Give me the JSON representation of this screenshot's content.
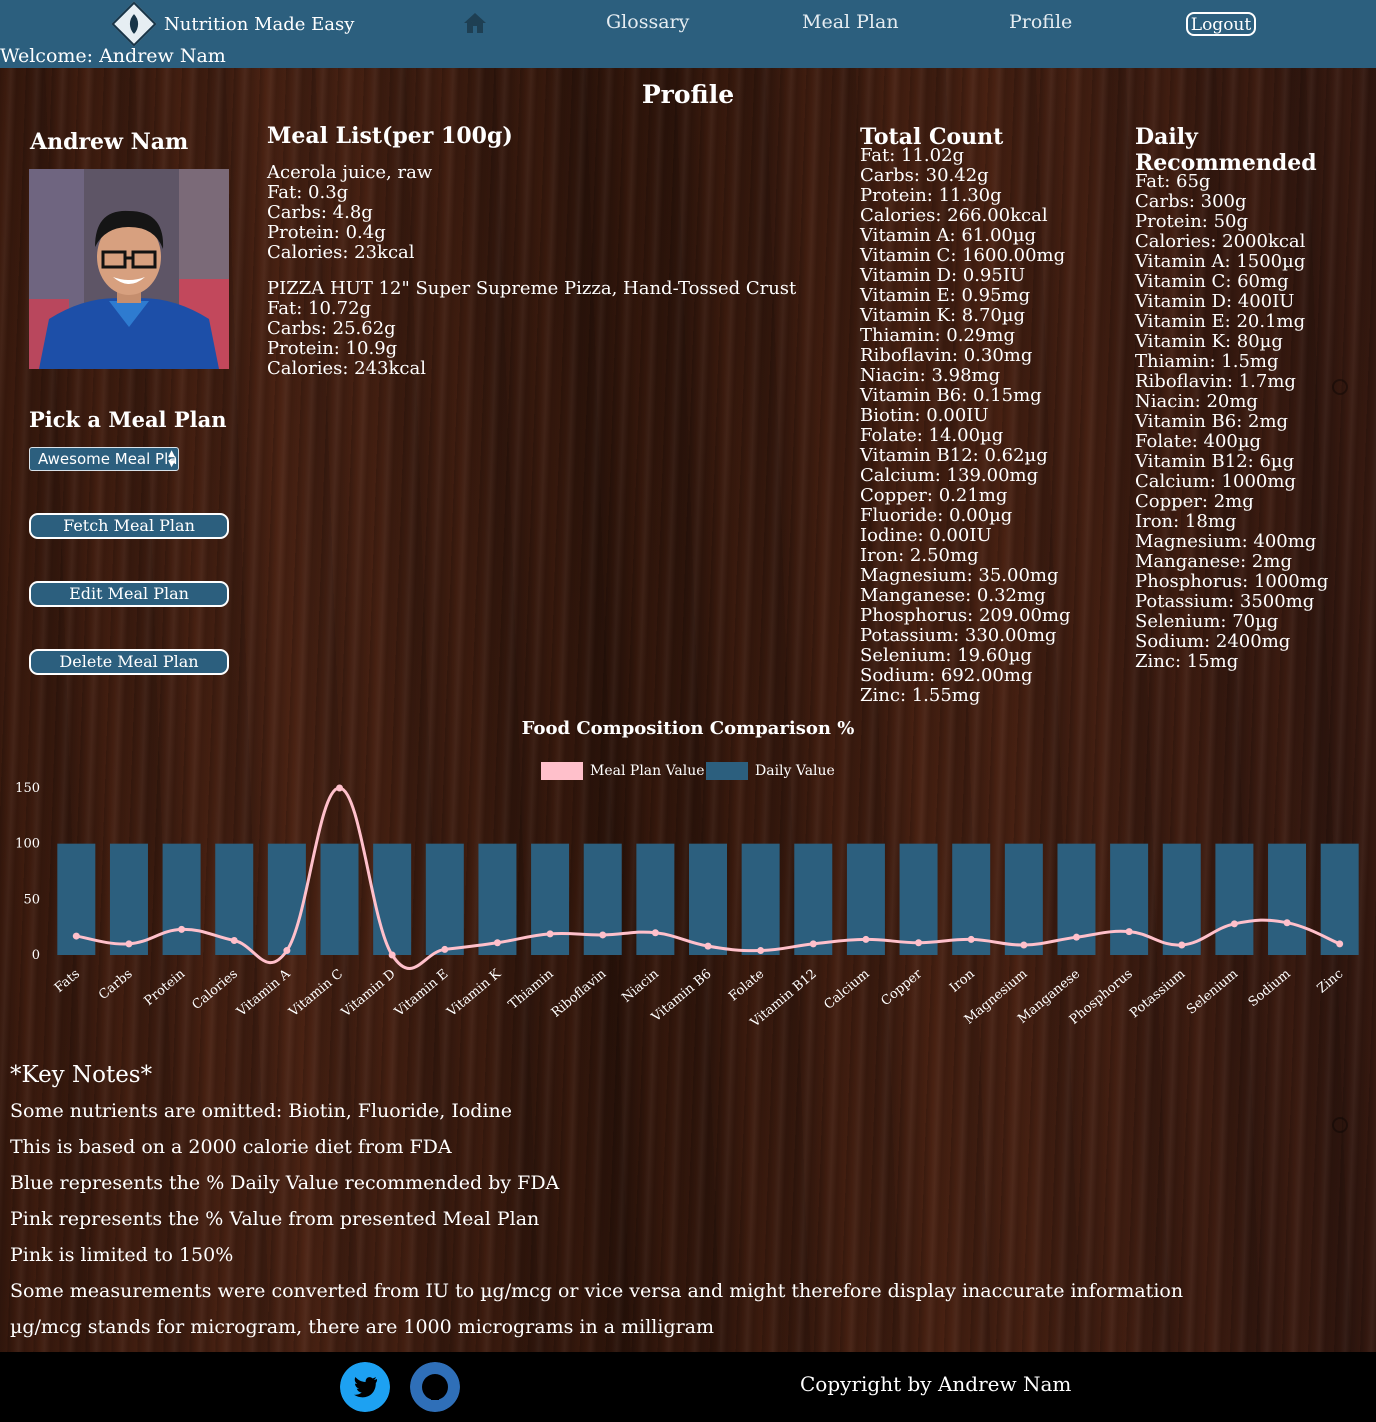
{
  "nav": {
    "brand": "Nutrition Made Easy",
    "links": [
      "Glossary",
      "Meal Plan",
      "Profile"
    ],
    "logout": "Logout",
    "welcome": "Welcome: Andrew Nam",
    "bar_color": "#2c5f7e"
  },
  "page_title": "Profile",
  "user": {
    "name": "Andrew Nam"
  },
  "meal_picker": {
    "title": "Pick a Meal Plan",
    "selected": "Awesome Meal Plan",
    "buttons": [
      "Fetch Meal Plan",
      "Edit Meal Plan",
      "Delete Meal Plan"
    ]
  },
  "meal_list": {
    "title": "Meal List(per 100g)",
    "items": [
      {
        "name": "Acerola juice, raw",
        "fat": "Fat: 0.3g",
        "carbs": "Carbs: 4.8g",
        "protein": "Protein: 0.4g",
        "calories": "Calories: 23kcal"
      },
      {
        "name": "PIZZA HUT 12\" Super Supreme Pizza, Hand-Tossed Crust",
        "fat": "Fat: 10.72g",
        "carbs": "Carbs: 25.62g",
        "protein": "Protein: 10.9g",
        "calories": "Calories: 243kcal"
      }
    ]
  },
  "total_count": {
    "title": "Total Count",
    "rows": [
      "Fat: 11.02g",
      "Carbs: 30.42g",
      "Protein: 11.30g",
      "Calories: 266.00kcal",
      "Vitamin A: 61.00µg",
      "Vitamin C: 1600.00mg",
      "Vitamin D: 0.95IU",
      "Vitamin E: 0.95mg",
      "Vitamin K: 8.70µg",
      "Thiamin: 0.29mg",
      "Riboflavin: 0.30mg",
      "Niacin: 3.98mg",
      "Vitamin B6: 0.15mg",
      "Biotin: 0.00IU",
      "Folate: 14.00µg",
      "Vitamin B12: 0.62µg",
      "Calcium: 139.00mg",
      "Copper: 0.21mg",
      "Fluoride: 0.00µg",
      "Iodine: 0.00IU",
      "Iron: 2.50mg",
      "Magnesium: 35.00mg",
      "Manganese: 0.32mg",
      "Phosphorus: 209.00mg",
      "Potassium: 330.00mg",
      "Selenium: 19.60µg",
      "Sodium: 692.00mg",
      "Zinc: 1.55mg"
    ]
  },
  "daily_recommended": {
    "title": "Daily Recommended",
    "rows": [
      "Fat: 65g",
      "Carbs: 300g",
      "Protein: 50g",
      "Calories: 2000kcal",
      "Vitamin A: 1500µg",
      "Vitamin C: 60mg",
      "Vitamin D: 400IU",
      "Vitamin E: 20.1mg",
      "Vitamin K: 80µg",
      "Thiamin: 1.5mg",
      "Riboflavin: 1.7mg",
      "Niacin: 20mg",
      "Vitamin B6: 2mg",
      "Folate: 400µg",
      "Vitamin B12: 6µg",
      "Calcium: 1000mg",
      "Copper: 2mg",
      "Iron: 18mg",
      "Magnesium: 400mg",
      "Manganese: 2mg",
      "Phosphorus: 1000mg",
      "Potassium: 3500mg",
      "Selenium: 70µg",
      "Sodium: 2400mg",
      "Zinc: 15mg"
    ]
  },
  "chart_data": {
    "type": "bar",
    "title": "Food Composition Comparison %",
    "categories": [
      "Fats",
      "Carbs",
      "Protein",
      "Calories",
      "Vitamin A",
      "Vitamin C",
      "Vitamin D",
      "Vitamin E",
      "Vitamin K",
      "Thiamin",
      "Riboflavin",
      "Niacin",
      "Vitamin B6",
      "Folate",
      "Vitamin B12",
      "Calcium",
      "Copper",
      "Iron",
      "Magnesium",
      "Manganese",
      "Phosphorus",
      "Potassium",
      "Selenium",
      "Sodium",
      "Zinc"
    ],
    "series": [
      {
        "name": "Meal Plan Value",
        "type": "line",
        "color": "#ffc0cb",
        "values": [
          17,
          10,
          23,
          13,
          4,
          150,
          0,
          5,
          11,
          19,
          18,
          20,
          8,
          4,
          10,
          14,
          11,
          14,
          9,
          16,
          21,
          9,
          28,
          29,
          10
        ]
      },
      {
        "name": "Daily Value",
        "type": "bar",
        "color": "#2c5f7e",
        "values": [
          100,
          100,
          100,
          100,
          100,
          100,
          100,
          100,
          100,
          100,
          100,
          100,
          100,
          100,
          100,
          100,
          100,
          100,
          100,
          100,
          100,
          100,
          100,
          100,
          100
        ]
      }
    ],
    "yticks": [
      0,
      50,
      100,
      150
    ],
    "ylim": [
      0,
      150
    ]
  },
  "key_notes": {
    "title": "*Key Notes*",
    "lines": [
      "Some nutrients are omitted: Biotin, Fluoride, Iodine",
      "This is based on a 2000 calorie diet from FDA",
      "Blue represents the % Daily Value recommended by FDA",
      "Pink represents the % Value from presented Meal Plan",
      "Pink is limited to 150%",
      "Some measurements were converted from IU to µg/mcg or vice versa and might therefore display inaccurate information",
      "µg/mcg stands for microgram, there are 1000 micrograms in a milligram"
    ]
  },
  "footer": {
    "copyright": "Copyright by Andrew Nam",
    "icons": [
      "twitter-icon",
      "github-icon"
    ]
  }
}
